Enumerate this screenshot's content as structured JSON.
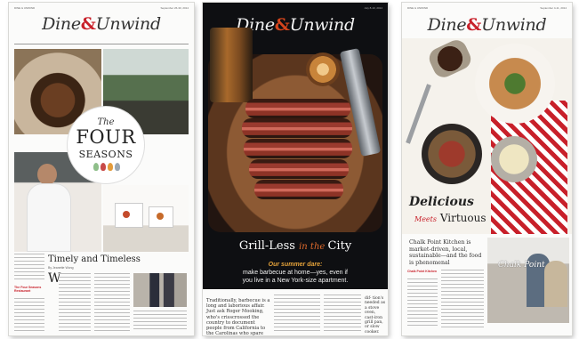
{
  "pages": [
    {
      "header_left": "DINE & UNWIND",
      "header_right": "September 26-30, 2014",
      "masthead": {
        "left": "Dine",
        "amp": "&",
        "right": "Unwind"
      },
      "seal": {
        "the": "The",
        "four": "FOUR",
        "seasons": "SEASONS"
      },
      "headline": "Timely and Timeless",
      "byline": "By Jeanette Wong",
      "dropcap": "W",
      "sidebar_title": "The Four Seasons Restaurant"
    },
    {
      "header_right": "July 8-10, 2014",
      "masthead": {
        "left": "Dine",
        "amp": "&",
        "right": "Unwind"
      },
      "headline": {
        "main": "Grill-Less ",
        "small": "in the ",
        "end": "City"
      },
      "deck": {
        "accent": "Our summer dare:",
        "line1": "make barbecue at home—yes, even if",
        "line2": "you live in a New York-size apartment."
      },
      "lead": "Traditionally, barbecue is a long and laborious affair. Just ask Roger Mooking, who's crisscrossed the country to document people from California to the Carolinas who spare the better part of a weekend tending to their hun-",
      "side_text": "dif- tion's needed as a stove oven, cast-iron grill pan, or slow cooker."
    },
    {
      "header_left": "DINE & UNWIND",
      "header_right": "September 4-11, 2014",
      "masthead": {
        "left": "Dine",
        "amp": "&",
        "right": "Unwind"
      },
      "headline_line1": "Delicious",
      "headline_meets": "Meets",
      "headline_line2": "Virtuous",
      "deck": "Chalk Point Kitchen is market-driven, local, sustainable—and the food is phenomenal",
      "sidebar_title": "Chalk Point Kitchen",
      "sign": "Chalk Point"
    }
  ]
}
